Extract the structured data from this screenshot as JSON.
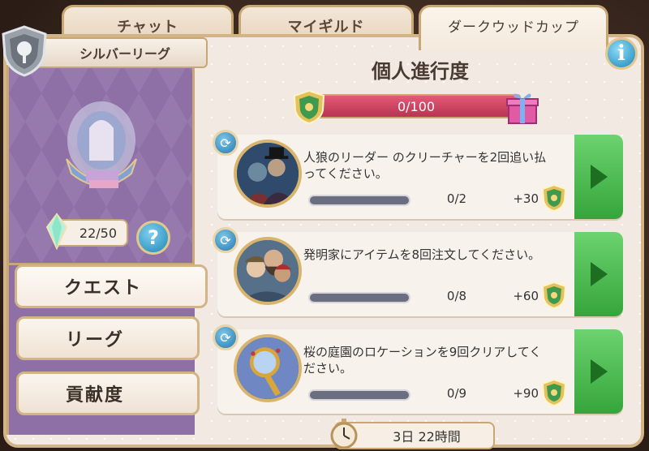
{
  "tabs": [
    {
      "label": "チャット"
    },
    {
      "label": "マイギルド"
    },
    {
      "label": "ダークウッドカップ"
    }
  ],
  "league": {
    "name": "シルバーリーグ",
    "gems": "22/50"
  },
  "side_menu": [
    {
      "label": "クエスト"
    },
    {
      "label": "リーグ"
    },
    {
      "label": "貢献度"
    }
  ],
  "header": {
    "title": "個人進行度",
    "progress_text": "0/100",
    "progress_fraction": 0.0
  },
  "quests": [
    {
      "text": "人狼のリーダー のクリーチャーを2回追い払ってください。",
      "progress": "0/2",
      "reward": "+30",
      "portrait": "werewolf-leader"
    },
    {
      "text": "発明家にアイテムを8回注文してください。",
      "progress": "0/8",
      "reward": "+60",
      "portrait": "inventors"
    },
    {
      "text": "桜の庭園のロケーションを9回クリアしてください。",
      "progress": "0/9",
      "reward": "+90",
      "portrait": "magic-mirror"
    }
  ],
  "timer": "3日 22時間",
  "colors": {
    "progress": "#cf4566",
    "play": "#4dbb52",
    "panel": "#f2e9e2",
    "sidebar": "#8e6fa6"
  }
}
